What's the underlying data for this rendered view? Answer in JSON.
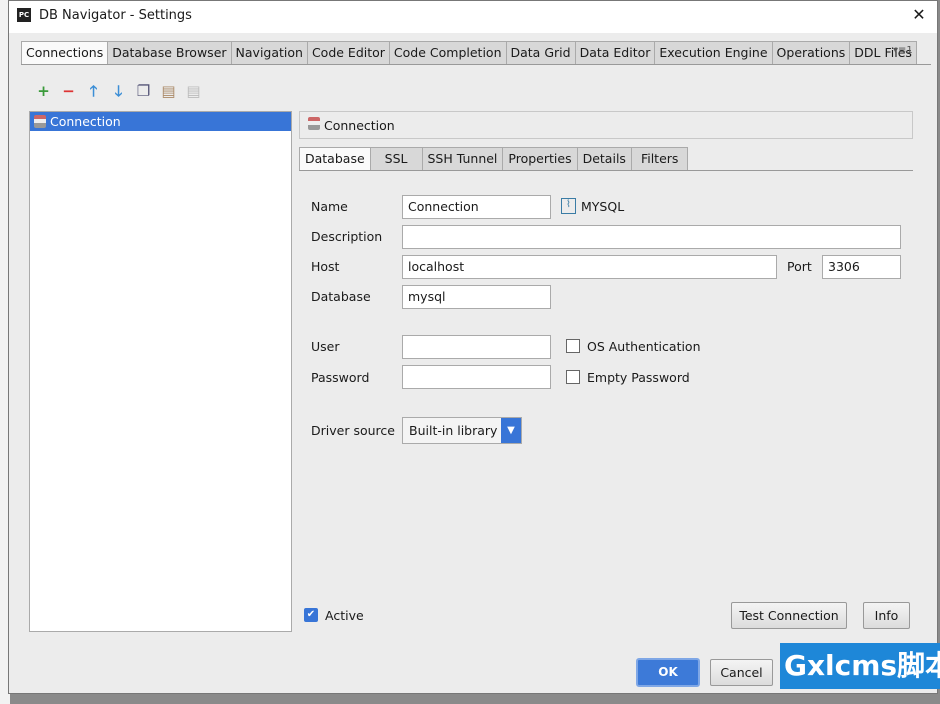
{
  "window": {
    "title": "DB Navigator - Settings",
    "app_icon": "PC"
  },
  "tabs": [
    "Connections",
    "Database Browser",
    "Navigation",
    "Code Editor",
    "Code Completion",
    "Data Grid",
    "Data Editor",
    "Execution Engine",
    "Operations",
    "DDL Files"
  ],
  "tabs_overflow": "▾≡1",
  "connections": [
    {
      "name": "Connection",
      "selected": true
    }
  ],
  "panel": {
    "header": "Connection",
    "subtabs": [
      "Database",
      "SSL",
      "SSH Tunnel",
      "Properties",
      "Details",
      "Filters"
    ],
    "active_subtab": "Database"
  },
  "form": {
    "name_label": "Name",
    "name_value": "Connection",
    "db_type": "MYSQL",
    "description_label": "Description",
    "description_value": "",
    "host_label": "Host",
    "host_value": "localhost",
    "port_label": "Port",
    "port_value": "3306",
    "database_label": "Database",
    "database_value": "mysql",
    "user_label": "User",
    "user_value": "",
    "password_label": "Password",
    "password_value": "",
    "os_auth_label": "OS Authentication",
    "os_auth_checked": false,
    "empty_password_label": "Empty Password",
    "empty_password_checked": false,
    "driver_label": "Driver source",
    "driver_value": "Built-in library",
    "active_label": "Active",
    "active_checked": true
  },
  "buttons": {
    "test": "Test Connection",
    "info": "Info",
    "ok": "OK",
    "cancel": "Cancel"
  },
  "watermark": "Gxlcms脚本"
}
